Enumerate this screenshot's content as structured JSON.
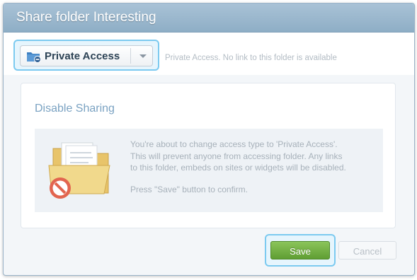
{
  "dialog": {
    "title": "Share folder Interesting",
    "access": {
      "selected": "Private Access",
      "hint": "Private Access. No link to this folder is available"
    },
    "panel": {
      "heading": "Disable Sharing",
      "info_lines": [
        "You're about to change access type to 'Private Access'.",
        "This will prevent anyone from accessing folder. Any links",
        "to this folder, embeds on sites or widgets will be disabled."
      ],
      "confirm": "Press \"Save\" button to confirm."
    },
    "buttons": {
      "save": "Save",
      "cancel": "Cancel"
    }
  },
  "colors": {
    "title_bar": "#9bb8ce",
    "focus_ring": "#7ccaf0",
    "save_green": "#6aa83c",
    "heading_blue": "#7aa2c2"
  },
  "icons": {
    "access": "private-folder-icon",
    "dropdown": "chevron-down-icon",
    "illustration": "folder-disabled-icon"
  }
}
